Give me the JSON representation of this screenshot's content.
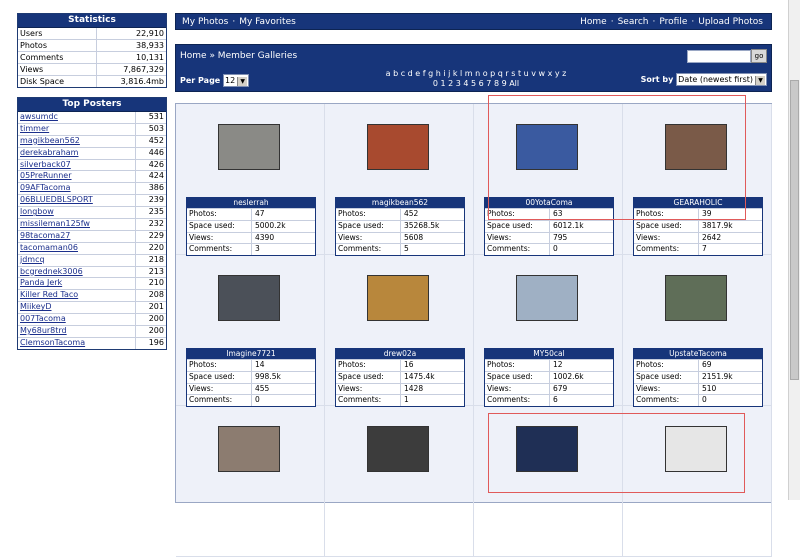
{
  "statistics": {
    "title": "Statistics",
    "rows": [
      {
        "label": "Users",
        "value": "22,910"
      },
      {
        "label": "Photos",
        "value": "38,933"
      },
      {
        "label": "Comments",
        "value": "10,131"
      },
      {
        "label": "Views",
        "value": "7,867,329"
      },
      {
        "label": "Disk Space",
        "value": "3,816.4mb"
      }
    ]
  },
  "top_posters": {
    "title": "Top Posters",
    "rows": [
      {
        "name": "awsumdc",
        "count": "531"
      },
      {
        "name": "timmer",
        "count": "503"
      },
      {
        "name": "magikbean562",
        "count": "452"
      },
      {
        "name": "derekabraham",
        "count": "446"
      },
      {
        "name": "silverback07",
        "count": "426"
      },
      {
        "name": "05PreRunner",
        "count": "424"
      },
      {
        "name": "09AFTacoma",
        "count": "386"
      },
      {
        "name": "06BLUEDBLSPORT",
        "count": "239"
      },
      {
        "name": "longbow",
        "count": "235"
      },
      {
        "name": "missileman125fw",
        "count": "232"
      },
      {
        "name": "98tacoma27",
        "count": "229"
      },
      {
        "name": "tacomaman06",
        "count": "220"
      },
      {
        "name": "jdmcq",
        "count": "218"
      },
      {
        "name": "bcgrednek3006",
        "count": "213"
      },
      {
        "name": "Panda Jerk",
        "count": "210"
      },
      {
        "name": "Killer Red Taco",
        "count": "208"
      },
      {
        "name": "MiikeyD",
        "count": "201"
      },
      {
        "name": "007Tacoma",
        "count": "200"
      },
      {
        "name": "My68ur8trd",
        "count": "200"
      },
      {
        "name": "ClemsonTacoma",
        "count": "196"
      }
    ]
  },
  "topnav": {
    "my_photos": "My Photos",
    "my_favorites": "My Favorites",
    "home": "Home",
    "search": "Search",
    "profile": "Profile",
    "upload": "Upload Photos",
    "sep": "·"
  },
  "subbar": {
    "breadcrumb": "Home » Member Galleries",
    "go": "go",
    "per_page_label": "Per Page",
    "per_page_value": "12",
    "alphabet_row1": "a b c d e f g h i j k l m n o p q r s t u v w x y z",
    "alphabet_row2": "0 1 2 3 4 5 6 7 8 9 All",
    "sort_label": "Sort by",
    "sort_value": "Date (newest first)"
  },
  "labels": {
    "photos": "Photos:",
    "space": "Space used:",
    "views": "Views:",
    "comments": "Comments:"
  },
  "galleries": [
    {
      "user": "neslerrah",
      "photos": "47",
      "space": "5000.2k",
      "views": "4390",
      "comments": "3",
      "thumb_bg": "#8a8a86"
    },
    {
      "user": "magikbean562",
      "photos": "452",
      "space": "35268.5k",
      "views": "5608",
      "comments": "5",
      "thumb_bg": "#a84a2f"
    },
    {
      "user": "00YotaComa",
      "photos": "63",
      "space": "6012.1k",
      "views": "795",
      "comments": "0",
      "thumb_bg": "#3a5aa0"
    },
    {
      "user": "GEARAHOLIC",
      "photos": "39",
      "space": "3817.9k",
      "views": "2642",
      "comments": "7",
      "thumb_bg": "#7a5a48"
    },
    {
      "user": "Imagine7721",
      "photos": "14",
      "space": "998.5k",
      "views": "455",
      "comments": "0",
      "thumb_bg": "#4b5058"
    },
    {
      "user": "drew02a",
      "photos": "16",
      "space": "1475.4k",
      "views": "1428",
      "comments": "1",
      "thumb_bg": "#b8873c"
    },
    {
      "user": "MY50cal",
      "photos": "12",
      "space": "1002.6k",
      "views": "679",
      "comments": "6",
      "thumb_bg": "#9fb0c4"
    },
    {
      "user": "UpstateTacoma",
      "photos": "69",
      "space": "2151.9k",
      "views": "510",
      "comments": "0",
      "thumb_bg": "#5f6e58"
    },
    {
      "thumb_bg": "#8c7c70"
    },
    {
      "thumb_bg": "#3c3c3c"
    },
    {
      "thumb_bg": "#1f2f55"
    },
    {
      "thumb_bg": "#e6e6e6"
    }
  ]
}
